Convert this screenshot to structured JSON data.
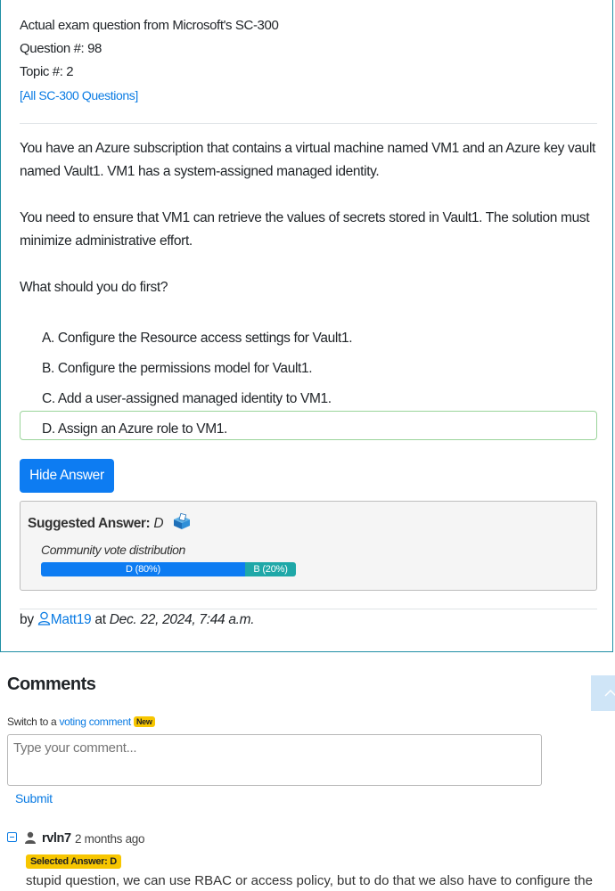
{
  "question": {
    "header": "Actual exam question from Microsoft's SC-300",
    "number": "Question #: 98",
    "topic": "Topic #: 2",
    "all_link": "[All SC-300 Questions]",
    "paragraphs": [
      "You have an Azure subscription that contains a virtual machine named VM1 and an Azure key vault named Vault1. VM1 has a system-assigned managed identity.",
      "You need to ensure that VM1 can retrieve the values of secrets stored in Vault1. The solution must minimize administrative effort.",
      "What should you do first?"
    ],
    "choices": [
      "A. Configure the Resource access settings for Vault1.",
      "B. Configure the permissions model for Vault1.",
      "C. Add a user-assigned managed identity to VM1.",
      "D. Assign an Azure role to VM1."
    ]
  },
  "answer": {
    "hide_button": "Hide Answer",
    "suggested_label": "Suggested Answer:",
    "suggested_letter": "D",
    "vote_label": "Community vote distribution",
    "votes": [
      {
        "label": "D (80%)",
        "fraction": 0.8,
        "color": "#0d7cf2"
      },
      {
        "label": "B (20%)",
        "fraction": 0.2,
        "color": "#1fa8a8"
      }
    ]
  },
  "byline": {
    "by": "by",
    "user": "Matt19",
    "at": "at",
    "date": "Dec. 22, 2024, 7:44 a.m."
  },
  "comments": {
    "title": "Comments",
    "switch_prefix": "Switch to a",
    "switch_link": "voting comment",
    "new_badge": "New",
    "placeholder": "Type your comment...",
    "submit": "Submit",
    "items": [
      {
        "user": "rvln7",
        "time": "2 months ago",
        "selected": "Selected Answer: D",
        "text": "stupid question, we can use RBAC or access policy, but to do that we also have to configure the"
      }
    ]
  },
  "colors": {
    "accent": "#0d7cf2",
    "card_border": "#1f8fa5",
    "correct_border": "#9ad49a",
    "badge": "#f7c600"
  }
}
